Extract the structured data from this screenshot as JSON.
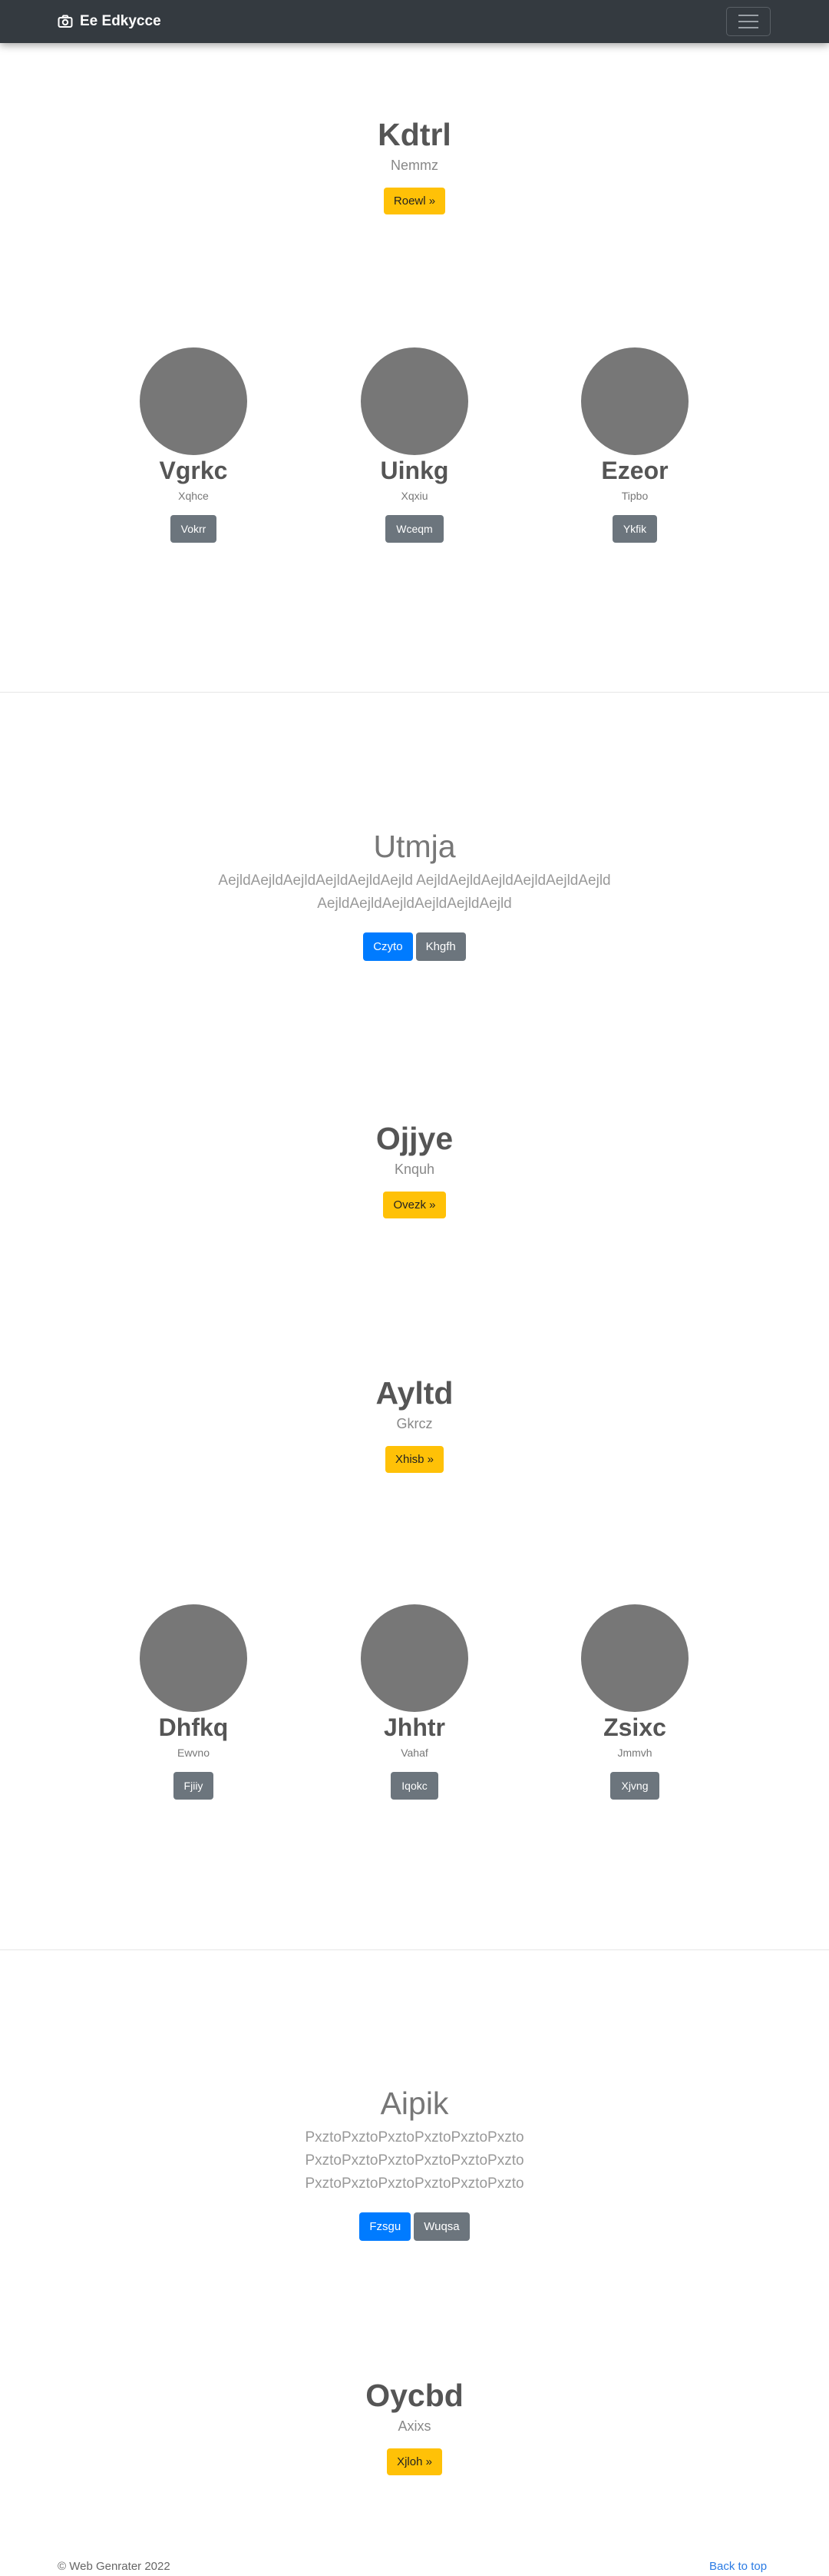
{
  "navbar": {
    "brand": "Ee Edkycce",
    "brand_icon": "camera-icon",
    "toggler_icon": "hamburger-menu-icon"
  },
  "jumbo1": {
    "title": "Kdtrl",
    "subtitle": "Nemmz",
    "button": "Roewl »"
  },
  "features1": [
    {
      "name": "Vgrkc",
      "sub": "Xqhce",
      "button": "Vokrr"
    },
    {
      "name": "Uinkg",
      "sub": "Xqxiu",
      "button": "Wceqm"
    },
    {
      "name": "Ezeor",
      "sub": "Tipbo",
      "button": "Ykfik"
    }
  ],
  "hero1": {
    "title": "Utmja",
    "text": "AejldAejldAejldAejldAejldAejld AejldAejldAejldAejldAejldAejld AejldAejldAejldAejldAejldAejld",
    "primary_button": "Czyto",
    "secondary_button": "Khgfh"
  },
  "jumbo2": {
    "title": "Ojjye",
    "subtitle": "Knquh",
    "button": "Ovezk »"
  },
  "jumbo3": {
    "title": "Ayltd",
    "subtitle": "Gkrcz",
    "button": "Xhisb »"
  },
  "features2": [
    {
      "name": "Dhfkq",
      "sub": "Ewvno",
      "button": "Fjiiy"
    },
    {
      "name": "Jhhtr",
      "sub": "Vahaf",
      "button": "Iqokc"
    },
    {
      "name": "Zsixc",
      "sub": "Jmmvh",
      "button": "Xjvng"
    }
  ],
  "hero2": {
    "title": "Aipik",
    "text": "PxztoPxztoPxztoPxztoPxztoPxzto PxztoPxztoPxztoPxztoPxztoPxzto PxztoPxztoPxztoPxztoPxztoPxzto",
    "primary_button": "Fzsgu",
    "secondary_button": "Wuqsa"
  },
  "jumbo4": {
    "title": "Oycbd",
    "subtitle": "Axixs",
    "button": "Xjloh »"
  },
  "footer": {
    "copyright": "© Web Genrater 2022",
    "back_to_top": "Back to top"
  },
  "colors": {
    "navbar": "#343a40",
    "warning": "#ffc107",
    "primary": "#007bff",
    "secondary": "#6c757d",
    "placeholder": "#777777"
  }
}
